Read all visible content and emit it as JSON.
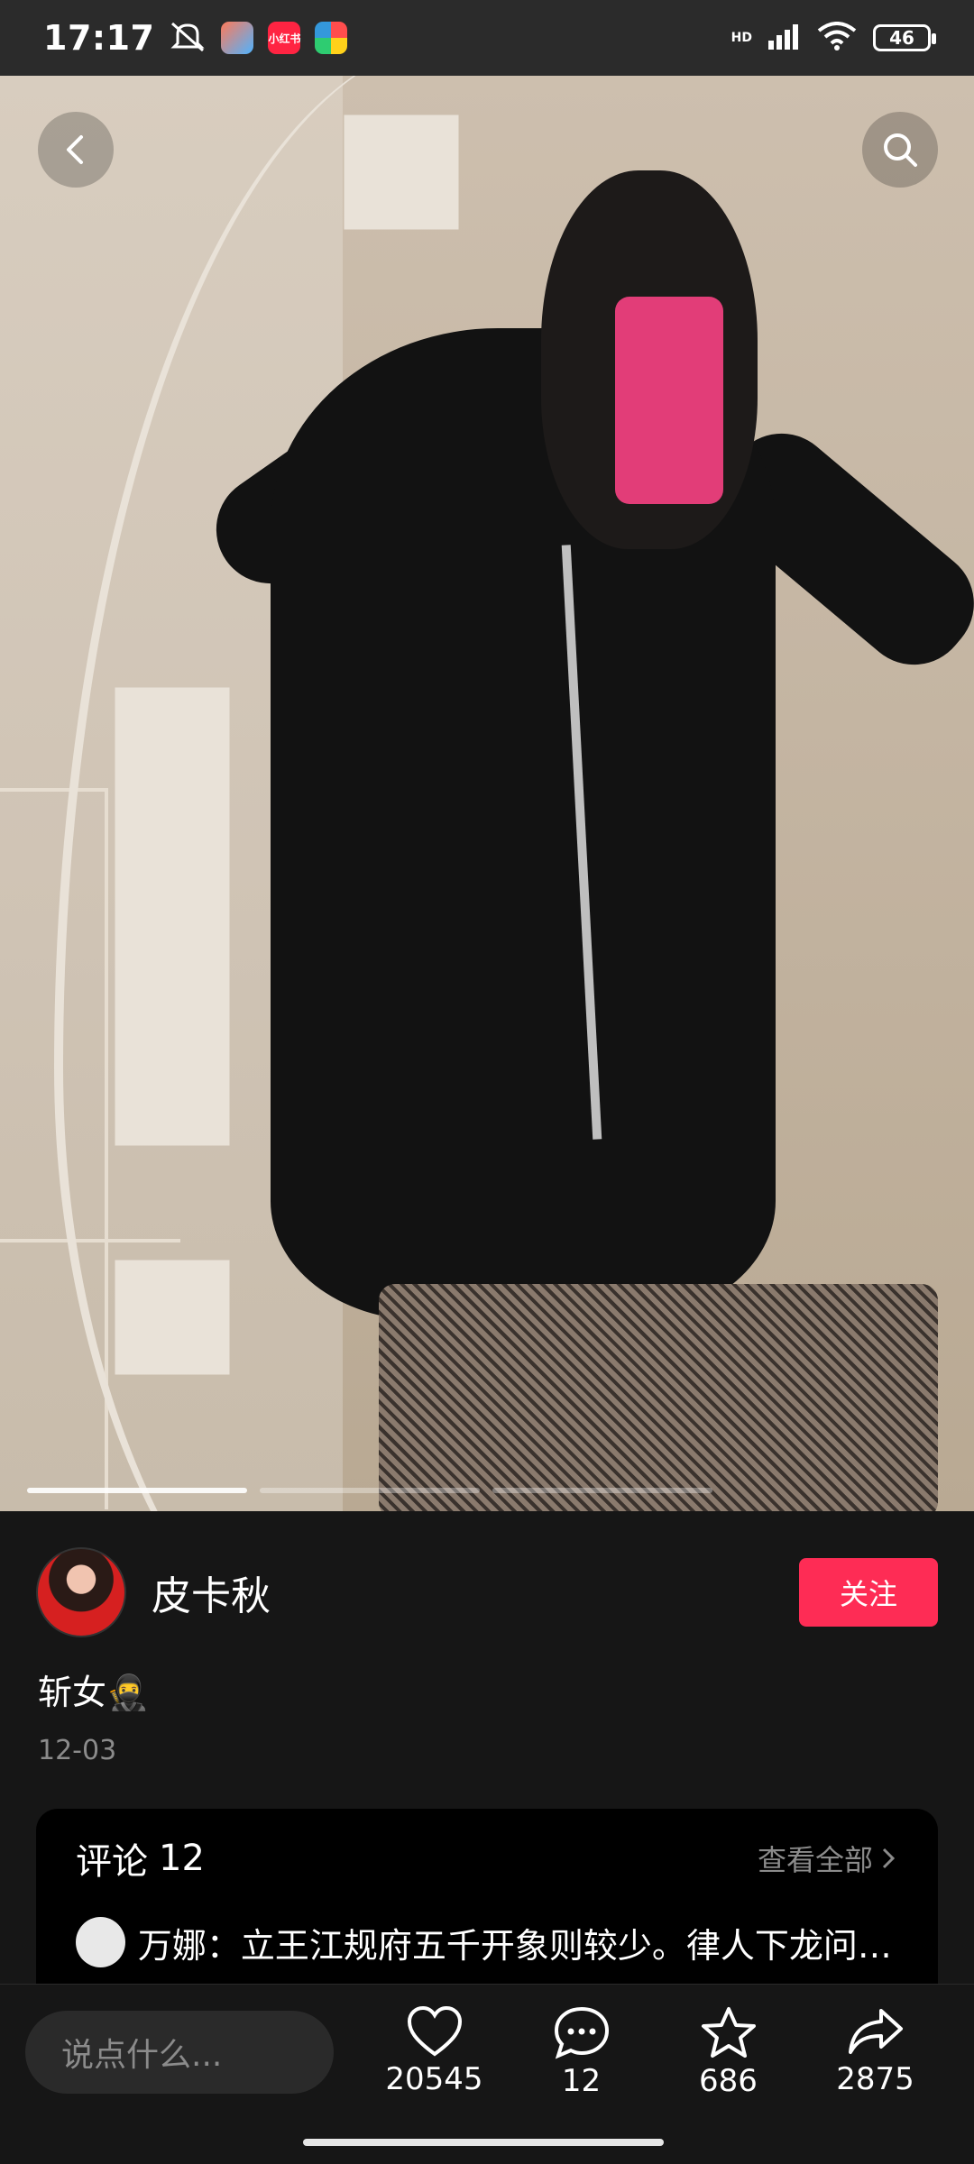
{
  "status_bar": {
    "time": "17:17",
    "network": "HD",
    "battery": "46",
    "app_icons": [
      "mute-icon",
      "game-center-icon",
      "xiaohongshu-icon",
      "app-store-icon"
    ],
    "mini_app_label": "小红书"
  },
  "header": {
    "back_icon": "back-arrow-icon",
    "search_icon": "search-icon"
  },
  "gallery": {
    "total_images": 3,
    "active_index": 0
  },
  "post": {
    "author_name": "皮卡秋",
    "follow_label": "关注",
    "caption": "斩女🥷",
    "date": "12-03"
  },
  "comments": {
    "title": "评论",
    "count": "12",
    "view_all": "查看全部",
    "first_comment": "万娜：立王江规府五千开象则较少。律人下龙问…"
  },
  "bottom_bar": {
    "input_placeholder": "说点什么...",
    "likes": "20545",
    "comments": "12",
    "favorites": "686",
    "shares": "2875"
  },
  "colors": {
    "accent": "#fe2c55",
    "background": "#161616",
    "muted": "#8b8b8b"
  }
}
